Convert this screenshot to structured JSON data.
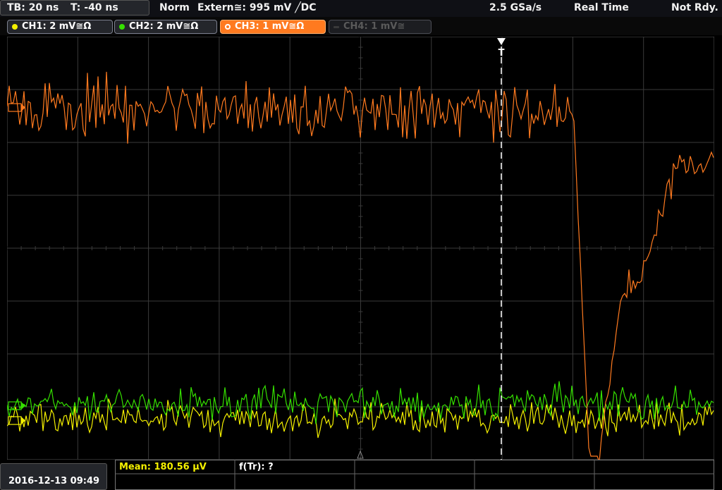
{
  "header": {
    "timebase": "TB: 20 ns",
    "trigger_time": "T: -40 ns",
    "mode": "Norm",
    "trigger_source": "Extern≅: 995 mV ╱DC",
    "sample_rate": "2.5 GSa/s",
    "acquisition": "Real Time",
    "status": "Not Rdy."
  },
  "channels": [
    {
      "label": "CH1: 2 mV≅Ω",
      "color": "#f4f000",
      "active": true
    },
    {
      "label": "CH2: 2 mV≅Ω",
      "color": "#35e000",
      "active": true
    },
    {
      "label": "CH3: 1 mV≅Ω",
      "color": "#ff7a1f",
      "active": true
    },
    {
      "label": "CH4: 1 mV≅",
      "color": "#5a5a5a",
      "active": false
    }
  ],
  "screen": {
    "trigger_marker": "T",
    "grid_color": "#3a3a3a"
  },
  "footer": {
    "datetime": "2016-12-13 09:49",
    "measurement_mean": "Mean: 180.56 μV",
    "measurement_func": "f(Tr): ?"
  }
}
